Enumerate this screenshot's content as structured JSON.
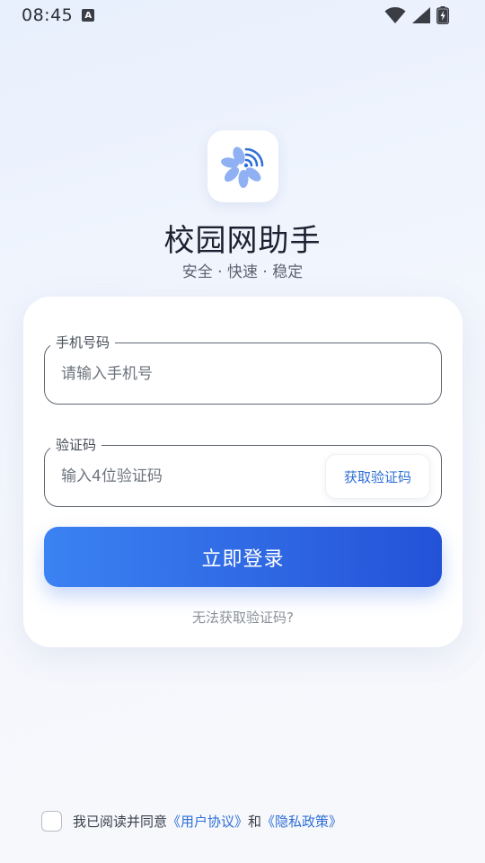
{
  "status_bar": {
    "time": "08:45",
    "notification_badge": "A",
    "icons": [
      "wifi-icon",
      "cellular-signal-icon",
      "battery-charging-icon"
    ]
  },
  "header": {
    "app_title": "校园网助手",
    "subtitle": "安全 · 快速 · 稳定",
    "logo_icon": "campus-network-logo-icon"
  },
  "form": {
    "phone": {
      "label": "手机号码",
      "placeholder": "请输入手机号",
      "value": ""
    },
    "code": {
      "label": "验证码",
      "placeholder": "输入4位验证码",
      "value": "",
      "get_code_label": "获取验证码"
    },
    "login_label": "立即登录",
    "help_link": "无法获取验证码?"
  },
  "agreement": {
    "checked": false,
    "prefix": "我已阅读并同意",
    "user_agreement": "《用户协议》",
    "conjunction": "和",
    "privacy_policy": "《隐私政策》"
  },
  "colors": {
    "accent": "#2f6fd6",
    "button_gradient_start": "#3b82f3",
    "button_gradient_end": "#2352d8",
    "background": "#f1f5fd"
  }
}
